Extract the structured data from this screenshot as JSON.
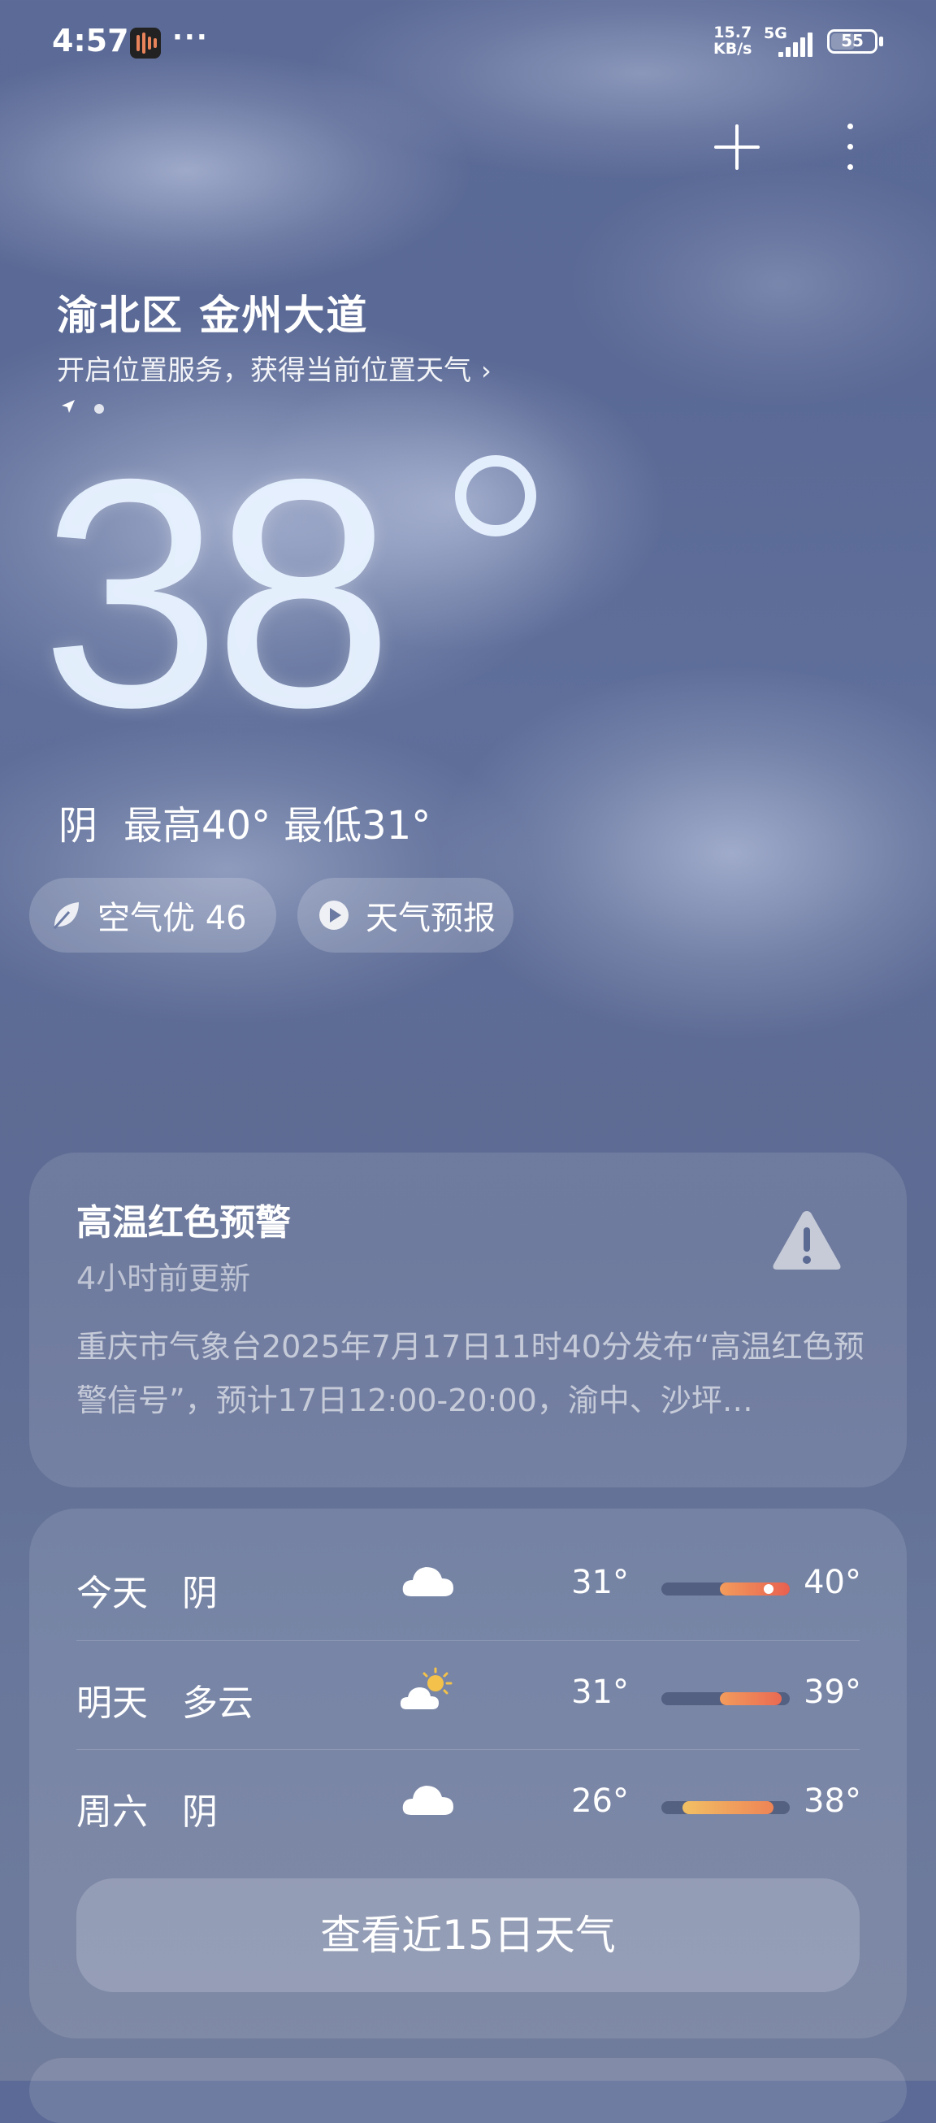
{
  "status_bar": {
    "time": "4:57",
    "notification_more": "···",
    "net_speed_value": "15.7",
    "net_speed_unit": "KB/s",
    "network_type": "5G",
    "battery_level": "55"
  },
  "toolbar": {
    "add_icon": "plus-icon",
    "menu_icon": "more-vertical-icon"
  },
  "location": {
    "name": "渝北区 金州大道",
    "service_tip": "开启位置服务，获得当前位置天气",
    "tip_arrow": "›"
  },
  "current": {
    "temperature": "38",
    "condition": "阴",
    "high": "最高40°",
    "low": "最低31°"
  },
  "chips": {
    "air_quality": "空气优 46",
    "forecast": "天气预报"
  },
  "warning": {
    "title": "高温红色预警",
    "updated": "4小时前更新",
    "body": "重庆市气象台2025年7月17日11时40分发布“高温红色预警信号”，预计17日12:00-20:00，渝中、沙坪…",
    "icon": "warning-triangle-icon"
  },
  "forecast": {
    "days": [
      {
        "day": "今天",
        "condition": "阴",
        "icon": "cloud-icon",
        "low": "31°",
        "high": "40°"
      },
      {
        "day": "明天",
        "condition": "多云",
        "icon": "partly-cloudy-icon",
        "low": "31°",
        "high": "39°"
      },
      {
        "day": "周六",
        "condition": "阴",
        "icon": "cloud-icon",
        "low": "26°",
        "high": "38°"
      }
    ],
    "more_button": "查看近15日天气"
  },
  "colors": {
    "bar_warm": "#f0855c",
    "bar_hot": "#e8604f",
    "bar_mild": "#f1b45e",
    "warning_icon": "#c7cbd8"
  }
}
